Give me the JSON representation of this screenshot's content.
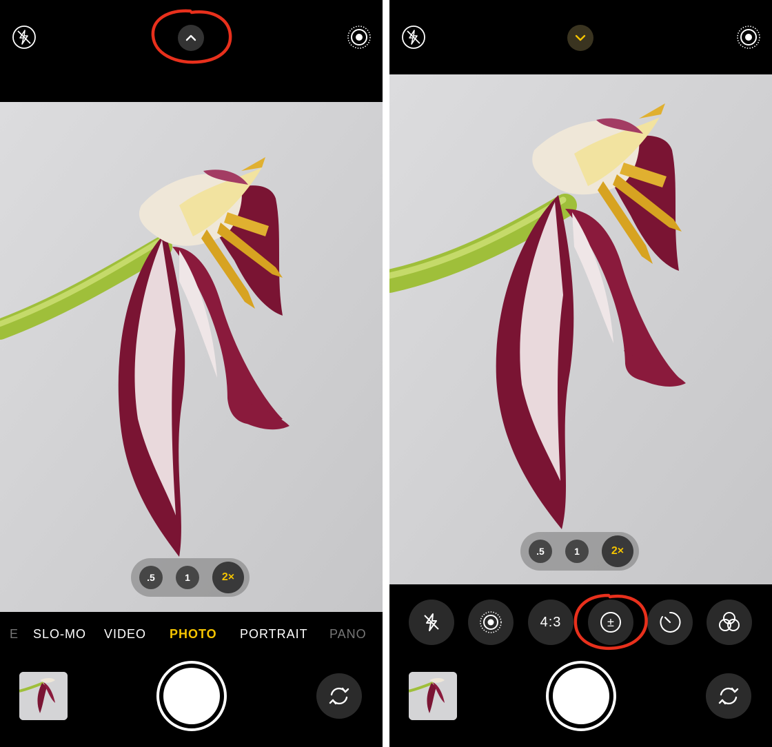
{
  "left_screen": {
    "top_bar": {
      "flash_icon": "flash-off-icon",
      "expand_icon": "chevron-up-icon",
      "live_photo_icon": "live-photo-icon"
    },
    "zoom": {
      "options": [
        ".5",
        "1",
        "2×"
      ],
      "selected": "2×"
    },
    "modes": [
      "E",
      "SLO-MO",
      "VIDEO",
      "PHOTO",
      "PORTRAIT",
      "PANO"
    ],
    "active_mode": "PHOTO",
    "bottom": {
      "thumbnail_icon": "last-photo-thumbnail",
      "shutter_icon": "shutter-button",
      "flip_icon": "camera-flip-icon"
    }
  },
  "right_screen": {
    "top_bar": {
      "flash_icon": "flash-off-icon",
      "collapse_icon": "chevron-down-icon",
      "live_photo_icon": "live-photo-icon"
    },
    "zoom": {
      "options": [
        ".5",
        "1",
        "2×"
      ],
      "selected": "2×"
    },
    "controls": [
      {
        "name": "flash-control",
        "icon": "flash-off-icon",
        "label": ""
      },
      {
        "name": "live-photo-control",
        "icon": "live-photo-icon",
        "label": ""
      },
      {
        "name": "aspect-ratio-control",
        "icon": "",
        "label": "4:3"
      },
      {
        "name": "exposure-control",
        "icon": "exposure-icon",
        "label": "±"
      },
      {
        "name": "timer-control",
        "icon": "timer-icon",
        "label": ""
      },
      {
        "name": "filters-control",
        "icon": "filters-icon",
        "label": ""
      }
    ],
    "bottom": {
      "thumbnail_icon": "last-photo-thumbnail",
      "shutter_icon": "shutter-button",
      "flip_icon": "camera-flip-icon"
    }
  },
  "colors": {
    "accent_yellow": "#f5c400",
    "annotation_red": "#e8301c",
    "background": "#000000"
  }
}
